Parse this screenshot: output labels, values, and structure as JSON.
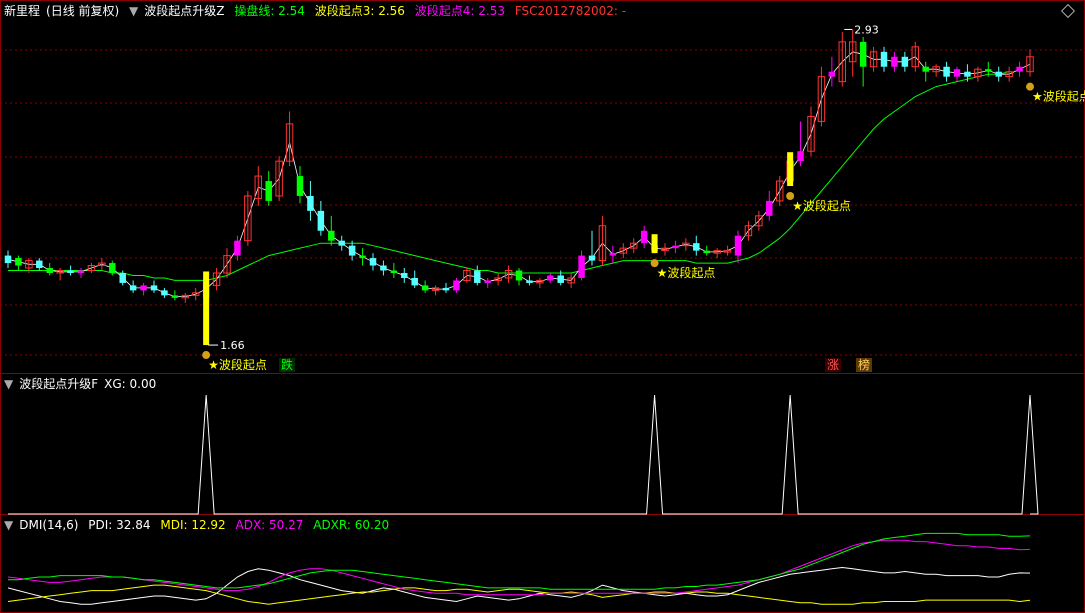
{
  "main_header": {
    "stock_name": "新里程",
    "period": "(日线 前复权)",
    "indicator": "波段起点升级Z",
    "lines": [
      {
        "label": "操盘线: 2.54",
        "color": "#00ff00"
      },
      {
        "label": "波段起点3: 2.56",
        "color": "#ffff00"
      },
      {
        "label": "波段起点4: 2.53",
        "color": "#ff00ff"
      },
      {
        "label": "FSC2012782002: -",
        "color": "#ff3333"
      }
    ]
  },
  "main_chart": {
    "high_label": "2.93",
    "low_label": "1.66",
    "signal_label": "波段起点",
    "tag_die": "跌",
    "tag_zhang": "涨",
    "tag_bang": "榜"
  },
  "sub1_header": {
    "indicator": "波段起点升级F",
    "value": "XG: 0.00"
  },
  "sub2_header": {
    "indicator": "DMI(14,6)",
    "pdi": "PDI: 32.84",
    "mdi": "MDI: 12.92",
    "adx": "ADX: 50.27",
    "adxr": "ADXR: 60.20"
  },
  "colors": {
    "up": "#ff3333",
    "down": "#54ffff",
    "bull": "#ff00ff",
    "bear": "#00ff00",
    "ma": "#00ff00",
    "border": "#8b0000",
    "grid": "#8b0000"
  },
  "chart_data": [
    {
      "type": "candlestick",
      "title": "波段起点升级Z",
      "ohlc": [
        [
          2.02,
          2.04,
          1.97,
          1.99
        ],
        [
          2.01,
          2.02,
          1.96,
          1.98
        ],
        [
          1.97,
          2.01,
          1.95,
          2.0
        ],
        [
          2.0,
          2.01,
          1.96,
          1.97
        ],
        [
          1.97,
          1.99,
          1.94,
          1.95
        ],
        [
          1.95,
          1.97,
          1.92,
          1.96
        ],
        [
          1.96,
          1.98,
          1.94,
          1.95
        ],
        [
          1.95,
          1.97,
          1.93,
          1.96
        ],
        [
          1.96,
          1.99,
          1.95,
          1.98
        ],
        [
          1.98,
          2.01,
          1.96,
          1.99
        ],
        [
          1.99,
          2.0,
          1.94,
          1.95
        ],
        [
          1.95,
          1.96,
          1.9,
          1.91
        ],
        [
          1.9,
          1.92,
          1.87,
          1.88
        ],
        [
          1.88,
          1.91,
          1.86,
          1.9
        ],
        [
          1.9,
          1.92,
          1.87,
          1.88
        ],
        [
          1.88,
          1.89,
          1.85,
          1.86
        ],
        [
          1.86,
          1.88,
          1.84,
          1.85
        ],
        [
          1.85,
          1.87,
          1.83,
          1.86
        ],
        [
          1.86,
          1.89,
          1.84,
          1.87
        ],
        [
          1.85,
          1.94,
          1.66,
          1.92
        ],
        [
          1.9,
          1.97,
          1.88,
          1.95
        ],
        [
          1.95,
          2.05,
          1.93,
          2.02
        ],
        [
          2.02,
          2.1,
          2.0,
          2.08
        ],
        [
          2.08,
          2.28,
          2.06,
          2.26
        ],
        [
          2.25,
          2.38,
          2.22,
          2.34
        ],
        [
          2.32,
          2.36,
          2.22,
          2.24
        ],
        [
          2.26,
          2.42,
          2.24,
          2.4
        ],
        [
          2.4,
          2.6,
          2.38,
          2.55
        ],
        [
          2.34,
          2.38,
          2.23,
          2.26
        ],
        [
          2.26,
          2.32,
          2.16,
          2.2
        ],
        [
          2.2,
          2.24,
          2.1,
          2.12
        ],
        [
          2.12,
          2.18,
          2.06,
          2.08
        ],
        [
          2.08,
          2.1,
          2.04,
          2.06
        ],
        [
          2.06,
          2.08,
          2.0,
          2.02
        ],
        [
          2.02,
          2.05,
          1.98,
          2.01
        ],
        [
          2.01,
          2.03,
          1.96,
          1.98
        ],
        [
          1.98,
          2.0,
          1.94,
          1.96
        ],
        [
          1.96,
          1.99,
          1.93,
          1.95
        ],
        [
          1.95,
          1.97,
          1.91,
          1.93
        ],
        [
          1.93,
          1.96,
          1.89,
          1.9
        ],
        [
          1.9,
          1.92,
          1.87,
          1.88
        ],
        [
          1.88,
          1.9,
          1.86,
          1.89
        ],
        [
          1.89,
          1.91,
          1.87,
          1.88
        ],
        [
          1.88,
          1.93,
          1.87,
          1.92
        ],
        [
          1.92,
          1.97,
          1.91,
          1.96
        ],
        [
          1.96,
          1.98,
          1.9,
          1.91
        ],
        [
          1.91,
          1.93,
          1.89,
          1.92
        ],
        [
          1.92,
          1.95,
          1.9,
          1.93
        ],
        [
          1.93,
          1.98,
          1.91,
          1.96
        ],
        [
          1.96,
          1.97,
          1.9,
          1.92
        ],
        [
          1.92,
          1.94,
          1.9,
          1.91
        ],
        [
          1.91,
          1.93,
          1.89,
          1.92
        ],
        [
          1.92,
          1.95,
          1.91,
          1.94
        ],
        [
          1.94,
          1.96,
          1.9,
          1.91
        ],
        [
          1.91,
          1.95,
          1.89,
          1.93
        ],
        [
          1.93,
          2.04,
          1.92,
          2.02
        ],
        [
          2.02,
          2.12,
          1.98,
          2.0
        ],
        [
          2.0,
          2.18,
          1.98,
          2.14
        ],
        [
          2.02,
          2.06,
          1.99,
          2.03
        ],
        [
          2.03,
          2.07,
          2.01,
          2.05
        ],
        [
          2.05,
          2.09,
          2.03,
          2.07
        ],
        [
          2.07,
          2.14,
          2.05,
          2.12
        ],
        [
          2.06,
          2.09,
          2.03,
          2.04
        ],
        [
          2.04,
          2.07,
          2.02,
          2.05
        ],
        [
          2.05,
          2.08,
          2.03,
          2.06
        ],
        [
          2.06,
          2.09,
          2.04,
          2.07
        ],
        [
          2.07,
          2.1,
          2.02,
          2.04
        ],
        [
          2.04,
          2.06,
          2.02,
          2.03
        ],
        [
          2.03,
          2.05,
          2.01,
          2.04
        ],
        [
          2.04,
          2.06,
          2.02,
          2.04
        ],
        [
          2.02,
          2.12,
          1.99,
          2.1
        ],
        [
          2.1,
          2.16,
          2.08,
          2.14
        ],
        [
          2.14,
          2.2,
          2.12,
          2.18
        ],
        [
          2.18,
          2.28,
          2.16,
          2.24
        ],
        [
          2.24,
          2.34,
          2.22,
          2.32
        ],
        [
          2.32,
          2.42,
          2.3,
          2.4
        ],
        [
          2.4,
          2.56,
          2.38,
          2.44
        ],
        [
          2.44,
          2.62,
          2.42,
          2.58
        ],
        [
          2.56,
          2.78,
          2.54,
          2.74
        ],
        [
          2.74,
          2.82,
          2.7,
          2.76
        ],
        [
          2.72,
          2.92,
          2.7,
          2.88
        ],
        [
          2.8,
          2.93,
          2.74,
          2.88
        ],
        [
          2.88,
          2.9,
          2.7,
          2.78
        ],
        [
          2.78,
          2.86,
          2.76,
          2.84
        ],
        [
          2.84,
          2.86,
          2.76,
          2.78
        ],
        [
          2.78,
          2.84,
          2.76,
          2.82
        ],
        [
          2.82,
          2.84,
          2.76,
          2.78
        ],
        [
          2.78,
          2.88,
          2.76,
          2.86
        ],
        [
          2.78,
          2.8,
          2.72,
          2.76
        ],
        [
          2.76,
          2.79,
          2.74,
          2.78
        ],
        [
          2.78,
          2.8,
          2.72,
          2.74
        ],
        [
          2.74,
          2.78,
          2.72,
          2.77
        ],
        [
          2.76,
          2.79,
          2.72,
          2.74
        ],
        [
          2.74,
          2.78,
          2.72,
          2.77
        ],
        [
          2.77,
          2.8,
          2.74,
          2.76
        ],
        [
          2.76,
          2.78,
          2.72,
          2.74
        ],
        [
          2.74,
          2.78,
          2.72,
          2.76
        ],
        [
          2.76,
          2.8,
          2.74,
          2.78
        ],
        [
          2.76,
          2.85,
          2.74,
          2.82
        ]
      ],
      "ma_line": [
        1.96,
        1.96,
        1.96,
        1.96,
        1.96,
        1.96,
        1.96,
        1.96,
        1.96,
        1.96,
        1.95,
        1.95,
        1.94,
        1.94,
        1.93,
        1.93,
        1.92,
        1.92,
        1.92,
        1.92,
        1.93,
        1.94,
        1.96,
        1.98,
        2.0,
        2.02,
        2.03,
        2.04,
        2.05,
        2.06,
        2.07,
        2.07,
        2.07,
        2.07,
        2.07,
        2.06,
        2.05,
        2.04,
        2.03,
        2.02,
        2.01,
        2.0,
        1.99,
        1.98,
        1.97,
        1.96,
        1.96,
        1.95,
        1.95,
        1.95,
        1.95,
        1.95,
        1.95,
        1.95,
        1.95,
        1.96,
        1.97,
        1.98,
        1.99,
        2.0,
        2.0,
        2.0,
        2.0,
        2.0,
        2.0,
        2.0,
        1.99,
        1.99,
        1.99,
        1.99,
        2.0,
        2.01,
        2.03,
        2.06,
        2.09,
        2.13,
        2.18,
        2.23,
        2.28,
        2.33,
        2.38,
        2.43,
        2.48,
        2.53,
        2.57,
        2.6,
        2.63,
        2.66,
        2.68,
        2.7,
        2.71,
        2.72,
        2.73,
        2.74,
        2.75,
        2.75,
        2.76
      ],
      "signals_at": [
        19,
        62,
        75,
        98
      ]
    },
    {
      "type": "line",
      "title": "波段起点升级F",
      "series": [
        {
          "name": "XG",
          "values_at_spikes": [
            1,
            1,
            1,
            1
          ],
          "spike_index": [
            19,
            62,
            75,
            98
          ]
        }
      ]
    },
    {
      "type": "line",
      "title": "DMI(14,6)",
      "series": [
        {
          "name": "PDI",
          "color": "#ffffff",
          "values": [
            22,
            20,
            18,
            16,
            14,
            12,
            11,
            10,
            10,
            11,
            12,
            13,
            14,
            15,
            16,
            16,
            15,
            14,
            13,
            14,
            18,
            24,
            30,
            34,
            36,
            35,
            33,
            31,
            28,
            26,
            24,
            22,
            20,
            19,
            18,
            20,
            22,
            21,
            19,
            17,
            15,
            14,
            13,
            12,
            14,
            16,
            15,
            14,
            13,
            14,
            16,
            18,
            17,
            16,
            15,
            17,
            20,
            24,
            22,
            20,
            19,
            18,
            17,
            16,
            17,
            18,
            17,
            16,
            16,
            17,
            20,
            23,
            26,
            28,
            30,
            32,
            33,
            34,
            35,
            36,
            37,
            36,
            35,
            34,
            33,
            33,
            34,
            33,
            32,
            32,
            31,
            31,
            31,
            31,
            30,
            30,
            32,
            33,
            32.84
          ]
        },
        {
          "name": "MDI",
          "color": "#ffff00",
          "values": [
            12,
            13,
            14,
            15,
            16,
            17,
            18,
            19,
            20,
            20,
            20,
            21,
            22,
            23,
            24,
            24,
            23,
            22,
            21,
            20,
            18,
            16,
            14,
            12,
            11,
            10,
            11,
            12,
            13,
            14,
            15,
            16,
            17,
            18,
            19,
            19,
            20,
            21,
            22,
            22,
            21,
            20,
            20,
            21,
            21,
            20,
            19,
            20,
            21,
            21,
            20,
            19,
            18,
            18,
            19,
            18,
            17,
            15,
            16,
            17,
            18,
            18,
            19,
            19,
            18,
            18,
            19,
            19,
            18,
            18,
            17,
            16,
            15,
            14,
            13,
            12,
            11,
            11,
            10,
            10,
            10,
            10,
            11,
            11,
            12,
            12,
            12,
            12,
            13,
            13,
            13,
            13,
            13,
            13,
            13,
            13,
            13,
            12,
            12.92
          ]
        },
        {
          "name": "ADX",
          "color": "#ff00ff",
          "values": [
            30,
            29,
            28,
            27,
            26,
            26,
            27,
            28,
            29,
            30,
            30,
            30,
            29,
            28,
            27,
            26,
            25,
            24,
            23,
            22,
            21,
            20,
            20,
            21,
            23,
            26,
            30,
            33,
            35,
            36,
            36,
            35,
            33,
            31,
            29,
            27,
            25,
            23,
            21,
            20,
            19,
            18,
            18,
            18,
            17,
            17,
            17,
            17,
            17,
            17,
            17,
            17,
            18,
            18,
            18,
            18,
            18,
            18,
            18,
            18,
            18,
            18,
            18,
            18,
            18,
            19,
            20,
            21,
            22,
            23,
            24,
            26,
            28,
            30,
            32,
            35,
            38,
            41,
            44,
            47,
            50,
            53,
            55,
            56,
            57,
            57,
            57,
            56,
            56,
            55,
            54,
            53,
            53,
            52,
            52,
            51,
            51,
            50,
            50.27
          ]
        },
        {
          "name": "ADXR",
          "color": "#00ff00",
          "values": [
            28,
            28,
            29,
            30,
            30,
            31,
            31,
            31,
            31,
            31,
            30,
            30,
            29,
            28,
            28,
            27,
            26,
            25,
            24,
            23,
            22,
            22,
            22,
            23,
            24,
            25,
            27,
            29,
            31,
            33,
            34,
            35,
            35,
            35,
            34,
            33,
            32,
            31,
            30,
            29,
            28,
            27,
            26,
            25,
            24,
            23,
            22,
            22,
            22,
            22,
            22,
            22,
            21,
            21,
            21,
            21,
            21,
            21,
            21,
            21,
            21,
            21,
            21,
            22,
            22,
            23,
            23,
            24,
            24,
            25,
            26,
            27,
            28,
            30,
            32,
            34,
            36,
            39,
            42,
            45,
            48,
            51,
            54,
            56,
            58,
            59,
            60,
            61,
            62,
            62,
            62,
            62,
            61,
            61,
            61,
            61,
            60,
            60,
            60.2
          ]
        }
      ]
    }
  ]
}
